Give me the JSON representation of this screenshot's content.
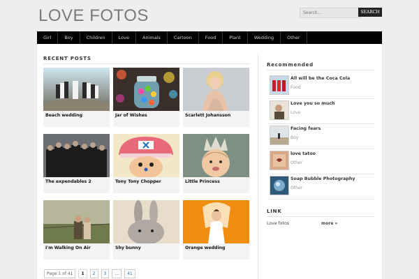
{
  "site": {
    "title": "LOVE FOTOS"
  },
  "search": {
    "placeholder": "Search...",
    "button": "SEARCH"
  },
  "nav": [
    "Girl",
    "Boy",
    "Children",
    "Love",
    "Animals",
    "Cartoon",
    "Food",
    "Plant",
    "Wedding",
    "Other"
  ],
  "recent_posts": {
    "title": "RECENT POSTS",
    "posts": [
      "Beach wedding",
      "Jar of Wishes",
      "Scarlett Johansson",
      "The expendables 2",
      "Tony Tony Chopper",
      "Little Princess",
      "I'm Walking On Air",
      "Shy bunny",
      "Orange wedding"
    ]
  },
  "pagination": {
    "status": "Page 1 of 41",
    "pages": [
      "1",
      "2",
      "3",
      "...",
      "41"
    ]
  },
  "recommended": {
    "title": "Recommended",
    "items": [
      {
        "title": "All will be the Coca Cola",
        "category": "Food"
      },
      {
        "title": "Love you so much",
        "category": "Love"
      },
      {
        "title": "Facing fears",
        "category": "Boy"
      },
      {
        "title": "love tatoo",
        "category": "Other"
      },
      {
        "title": "Soap Bubble Photography",
        "category": "Other"
      }
    ]
  },
  "links": {
    "title": "LINK",
    "name": "Love fotos",
    "more": "more »"
  }
}
